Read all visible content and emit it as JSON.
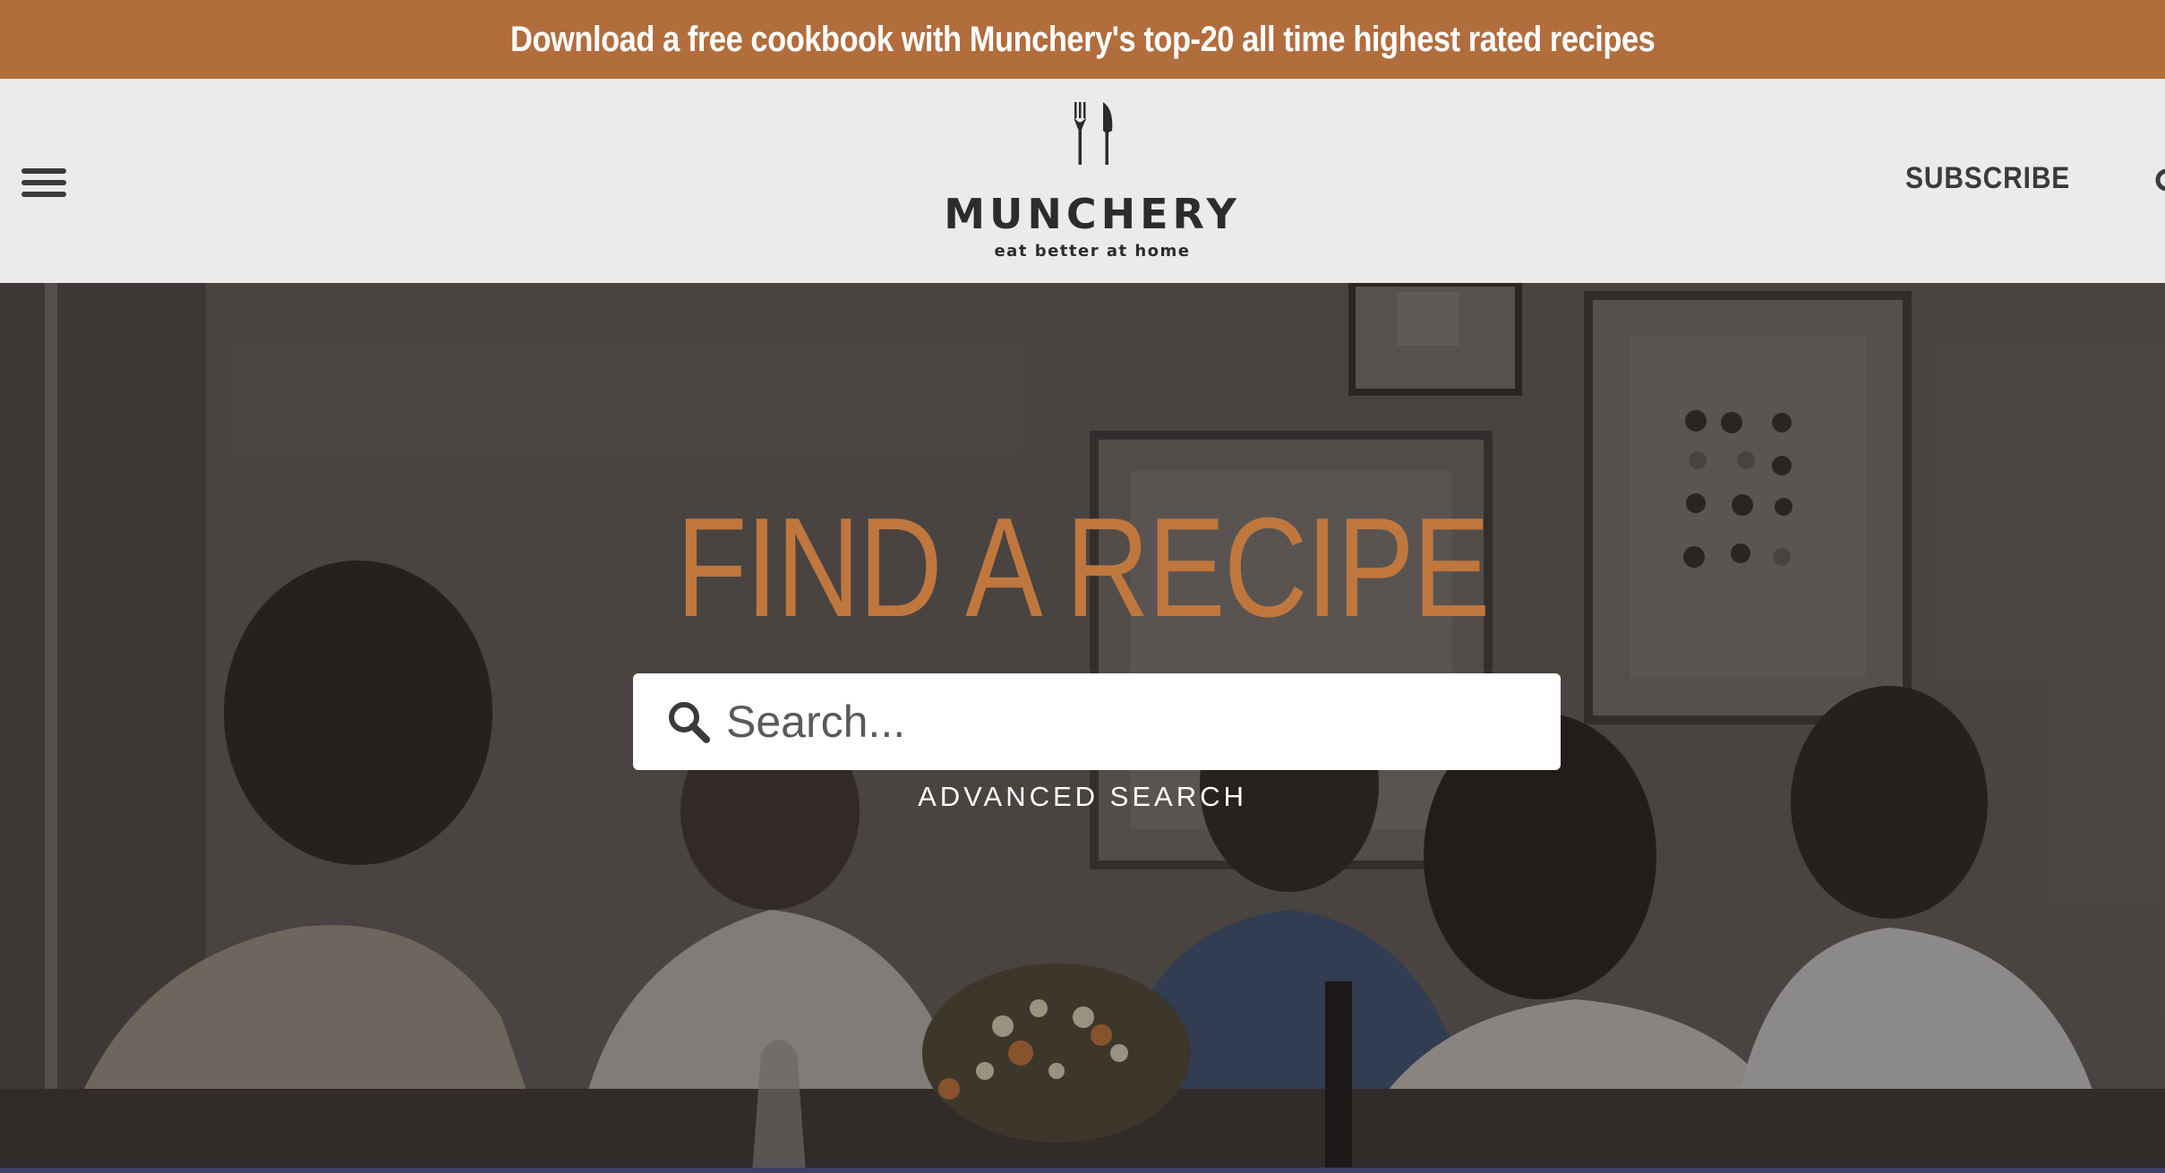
{
  "promo_banner": {
    "text": "Download a free cookbook with Munchery's top-20 all time highest rated recipes"
  },
  "header": {
    "menu_icon": "hamburger-menu-icon",
    "logo": {
      "name": "MUNCHERY",
      "tagline": "eat better at home",
      "icon": "fork-and-knife-icon"
    },
    "subscribe_label": "SUBSCRIBE",
    "search_icon": "search-icon"
  },
  "hero": {
    "title": "FIND A RECIPE",
    "search": {
      "placeholder": "Search...",
      "value": "",
      "icon": "search-icon"
    },
    "advanced_search_label": "ADVANCED SEARCH"
  },
  "colors": {
    "banner": "#b26d3d",
    "header_bg": "#ebebeb",
    "accent": "#c0773e",
    "text_dark": "#2c2c2c"
  }
}
